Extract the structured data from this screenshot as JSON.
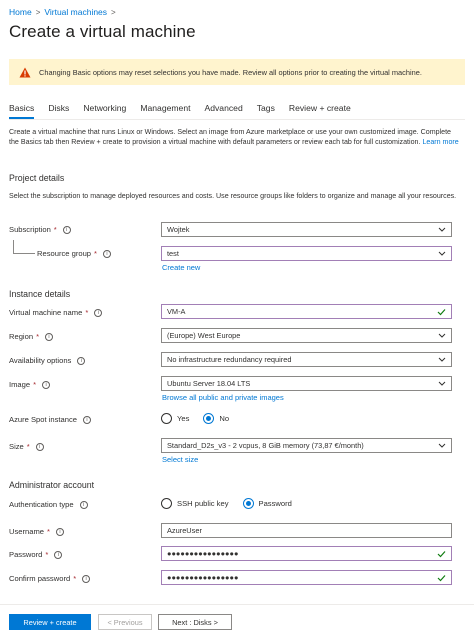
{
  "breadcrumb": {
    "home": "Home",
    "vms": "Virtual machines"
  },
  "title": "Create a virtual machine",
  "warning": "Changing Basic options may reset selections you have made. Review all options prior to creating the virtual machine.",
  "tabs": [
    "Basics",
    "Disks",
    "Networking",
    "Management",
    "Advanced",
    "Tags",
    "Review + create"
  ],
  "intro": {
    "text": "Create a virtual machine that runs Linux or Windows. Select an image from Azure marketplace or use your own customized image. Complete the Basics tab then Review + create to provision a virtual machine with default parameters or review each tab for full customization.",
    "learn_more": "Learn more"
  },
  "project": {
    "heading": "Project details",
    "desc": "Select the subscription to manage deployed resources and costs. Use resource groups like folders to organize and manage all your resources.",
    "subscription_label": "Subscription",
    "subscription_value": "Wojtek",
    "rg_label": "Resource group",
    "rg_value": "test",
    "create_new": "Create new"
  },
  "instance": {
    "heading": "Instance details",
    "vm_name_label": "Virtual machine name",
    "vm_name_value": "VM-A",
    "region_label": "Region",
    "region_value": "(Europe) West Europe",
    "avail_label": "Availability options",
    "avail_value": "No infrastructure redundancy required",
    "image_label": "Image",
    "image_value": "Ubuntu Server 18.04 LTS",
    "browse_images": "Browse all public and private images",
    "spot_label": "Azure Spot instance",
    "spot_yes": "Yes",
    "spot_no": "No",
    "size_label": "Size",
    "size_value": "Standard_D2s_v3 - 2 vcpus, 8 GiB memory (73,87 €/month)",
    "select_size": "Select size"
  },
  "admin": {
    "heading": "Administrator account",
    "auth_label": "Authentication type",
    "auth_ssh": "SSH public key",
    "auth_password": "Password",
    "username_label": "Username",
    "username_value": "AzureUser",
    "password_label": "Password",
    "password_value": "●●●●●●●●●●●●●●●●",
    "confirm_label": "Confirm password",
    "confirm_value": "●●●●●●●●●●●●●●●●"
  },
  "footer": {
    "review": "Review + create",
    "previous": "< Previous",
    "next": "Next : Disks >"
  },
  "colors": {
    "accent": "#0078d4",
    "warning_bg": "#fff4ce",
    "required": "#a4262c",
    "valid": "#107c10"
  }
}
